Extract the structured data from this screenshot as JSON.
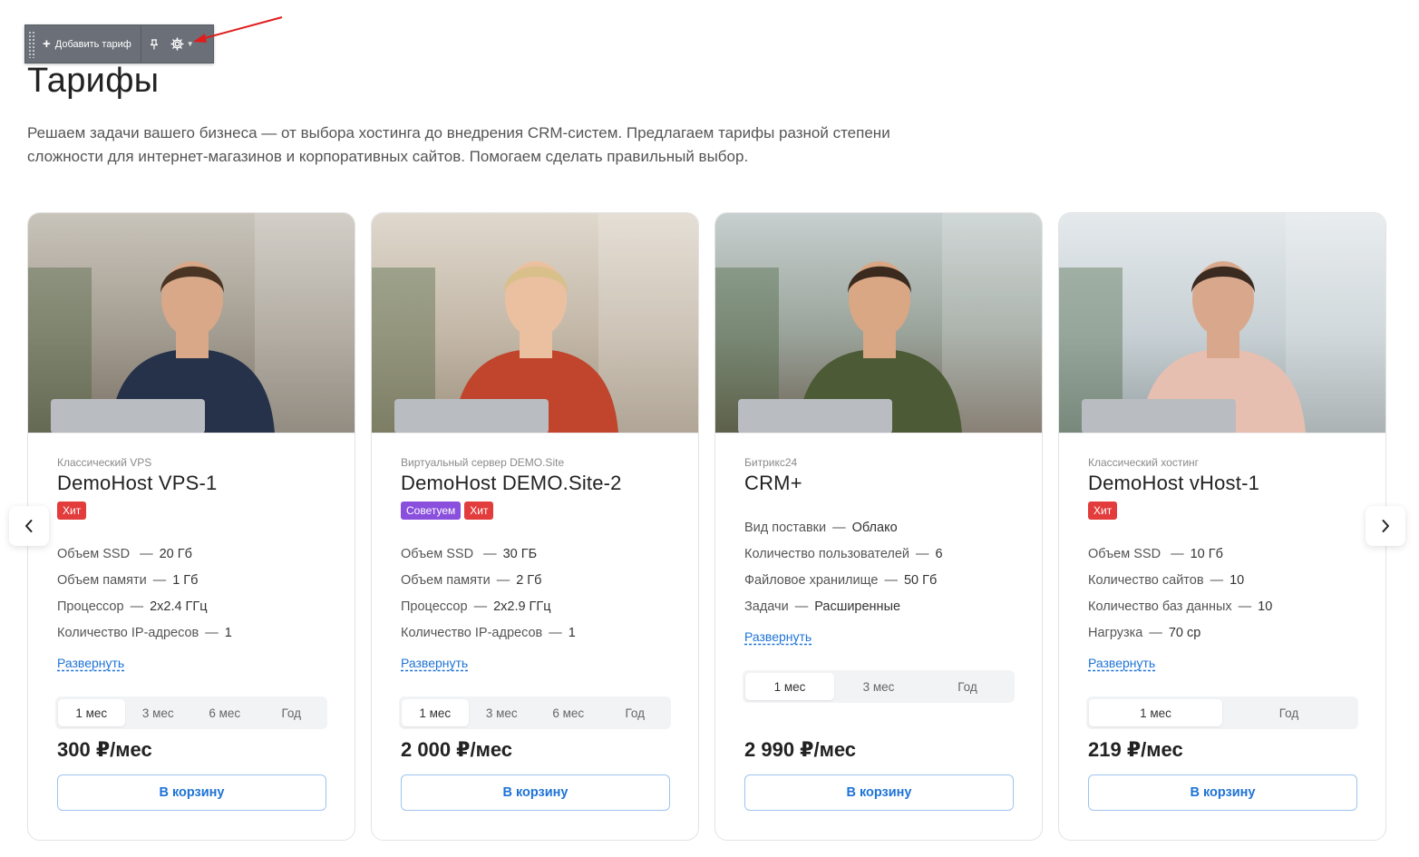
{
  "toolbar": {
    "add_label": "Добавить тариф",
    "pin_icon": "pin-icon",
    "gear_icon": "gear-icon"
  },
  "page": {
    "title": "Тарифы",
    "description": "Решаем задачи вашего бизнеса — от выбора хостинга до внедрения CRM-систем. Предлагаем тарифы разной степени сложности для интернет-магазинов и корпоративных сайтов. Помогаем сделать правильный выбор."
  },
  "carousel": {
    "prev_icon": "chevron-left-icon",
    "next_icon": "chevron-right-icon"
  },
  "colors": {
    "accent": "#1e73d6",
    "hit_badge": "#e33c3c",
    "recommend_badge": "#8a4fdd"
  },
  "cards": [
    {
      "category": "Классический VPS",
      "name": "DemoHost VPS-1",
      "badges": [
        {
          "label": "Хит",
          "type": "hit"
        }
      ],
      "specs": [
        {
          "key": "Объем SSD ",
          "value": "20 Гб"
        },
        {
          "key": "Объем памяти",
          "value": "1 Гб"
        },
        {
          "key": "Процессор",
          "value": "2x2.4 ГГц"
        },
        {
          "key": "Количество IP-адресов",
          "value": "1"
        }
      ],
      "expand_label": "Развернуть",
      "periods": [
        "1 мес",
        "3 мес",
        "6 мес",
        "Год"
      ],
      "active_period": "1 мес",
      "price": "300 ₽/мес",
      "cart_label": "В корзину"
    },
    {
      "category": "Виртуальный сервер DEMO.Site",
      "name": "DemoHost DEMO.Site-2",
      "badges": [
        {
          "label": "Советуем",
          "type": "rec"
        },
        {
          "label": "Хит",
          "type": "hit"
        }
      ],
      "specs": [
        {
          "key": "Объем SSD ",
          "value": "30 ГБ"
        },
        {
          "key": "Объем памяти",
          "value": "2 Гб"
        },
        {
          "key": "Процессор",
          "value": "2x2.9 ГГц"
        },
        {
          "key": "Количество IP-адресов",
          "value": "1"
        }
      ],
      "expand_label": "Развернуть",
      "periods": [
        "1 мес",
        "3 мес",
        "6 мес",
        "Год"
      ],
      "active_period": "1 мес",
      "price": "2 000 ₽/мес",
      "cart_label": "В корзину"
    },
    {
      "category": "Битрикс24",
      "name": "CRM+",
      "badges": [],
      "specs": [
        {
          "key": "Вид поставки",
          "value": "Облако"
        },
        {
          "key": "Количество пользователей",
          "value": "6"
        },
        {
          "key": "Файловое хранилище",
          "value": "50 Гб"
        },
        {
          "key": "Задачи",
          "value": "Расширенные"
        }
      ],
      "expand_label": "Развернуть",
      "periods": [
        "1 мес",
        "3 мес",
        "Год"
      ],
      "active_period": "1 мес",
      "price": "2 990 ₽/мес",
      "cart_label": "В корзину"
    },
    {
      "category": "Классический хостинг",
      "name": "DemoHost vHost-1",
      "badges": [
        {
          "label": "Хит",
          "type": "hit"
        }
      ],
      "specs": [
        {
          "key": "Объем SSD ",
          "value": "10 Гб"
        },
        {
          "key": "Количество сайтов",
          "value": "10"
        },
        {
          "key": "Количество баз данных",
          "value": "10"
        },
        {
          "key": "Нагрузка",
          "value": "70 ср"
        }
      ],
      "expand_label": "Развернуть",
      "periods": [
        "1 мес",
        "Год"
      ],
      "active_period": "1 мес",
      "price": "219 ₽/мес",
      "cart_label": "В корзину"
    }
  ]
}
